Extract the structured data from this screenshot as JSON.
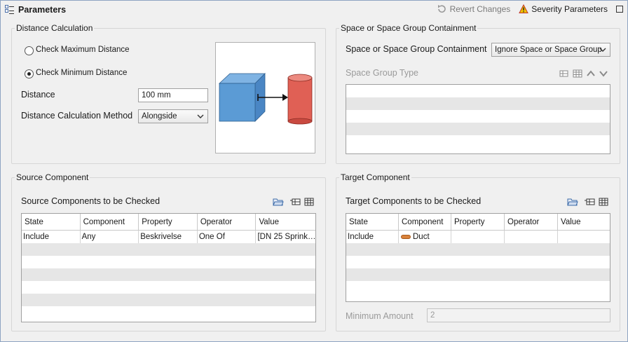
{
  "title": "Parameters",
  "header": {
    "revert_label": "Revert Changes",
    "severity_label": "Severity Parameters"
  },
  "distance_calc": {
    "group_title": "Distance Calculation",
    "option_max": "Check Maximum Distance",
    "option_min": "Check Minimum Distance",
    "selected_option": "min",
    "distance_label": "Distance",
    "distance_value": "100 mm",
    "method_label": "Distance Calculation Method",
    "method_value": "Alongside"
  },
  "space": {
    "group_title": "Space or Space Group Containment",
    "containment_label": "Space or Space Group Containment",
    "containment_value": "Ignore Space or Space Group",
    "type_label": "Space Group Type"
  },
  "source": {
    "group_title": "Source Component",
    "list_title": "Source Components to be Checked",
    "columns": [
      "State",
      "Component",
      "Property",
      "Operator",
      "Value"
    ],
    "rows": [
      [
        "Include",
        "Any",
        "Beskrivelse",
        "One Of",
        "[DN 25 Sprink…"
      ]
    ]
  },
  "target": {
    "group_title": "Target Component",
    "list_title": "Target Components to be Checked",
    "columns": [
      "State",
      "Component",
      "Property",
      "Operator",
      "Value"
    ],
    "rows": [
      [
        "Include",
        "Duct",
        "",
        "",
        ""
      ]
    ],
    "min_amount_label": "Minimum Amount",
    "min_amount_value": "2"
  },
  "colors": {
    "cube": "#5b9bd5",
    "cylinder": "#e06055",
    "duct_icon": "#d9823b",
    "warning": "#f2c200"
  }
}
